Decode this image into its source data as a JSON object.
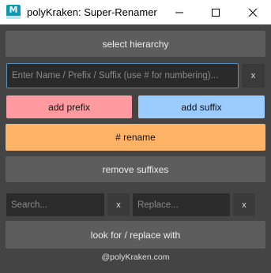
{
  "window": {
    "title": "polyKraken: Super-Renamer",
    "app_icon_letter": "M",
    "app_icon_name": "maya-app-icon",
    "controls": [
      "minimize-icon",
      "maximize-icon",
      "close-icon"
    ]
  },
  "buttons": {
    "select_hierarchy": "select hierarchy",
    "clear": "x",
    "add_prefix": "add prefix",
    "add_suffix": "add suffix",
    "rename": "# rename",
    "remove_suffixes": "remove suffixes",
    "look_for_replace": "look for / replace with"
  },
  "inputs": {
    "name_placeholder": "Enter Name / Prefix / Suffix (use # for numbering)...",
    "search_placeholder": "Search...",
    "replace_placeholder": "Replace..."
  },
  "footer": "@polyKraken.com",
  "colors": {
    "prefix": "#ff9aa0",
    "suffix": "#9ccbff",
    "rename": "#ffb366",
    "background": "#444444"
  }
}
